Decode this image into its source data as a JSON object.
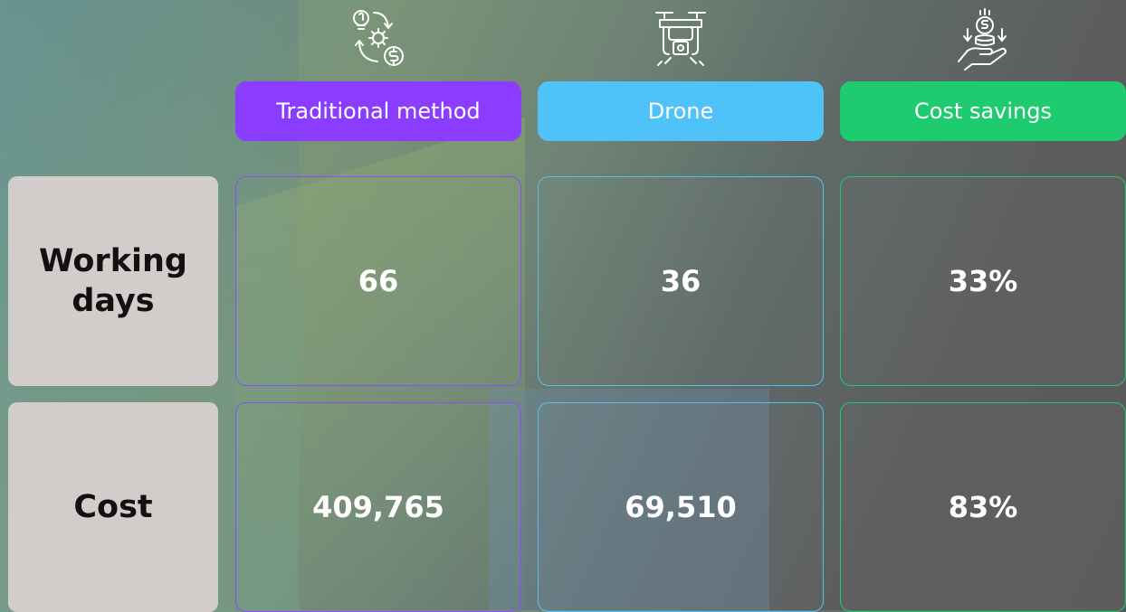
{
  "chart_data": {
    "type": "table",
    "columns": [
      "Traditional method",
      "Drone",
      "Cost savings"
    ],
    "rows": [
      {
        "label": "Working days",
        "values": [
          "66",
          "36",
          "33%"
        ]
      },
      {
        "label": "Cost",
        "values": [
          "409,765",
          "69,510",
          "83%"
        ]
      }
    ]
  },
  "icons": {
    "traditional": "process-gear-dollar-icon",
    "drone": "drone-icon",
    "savings": "hand-coins-icon"
  },
  "colors": {
    "traditional": "#8b3dff",
    "drone": "#4fc3f7",
    "savings": "#1ecb6e",
    "row_label_bg": "#d2cccb"
  }
}
